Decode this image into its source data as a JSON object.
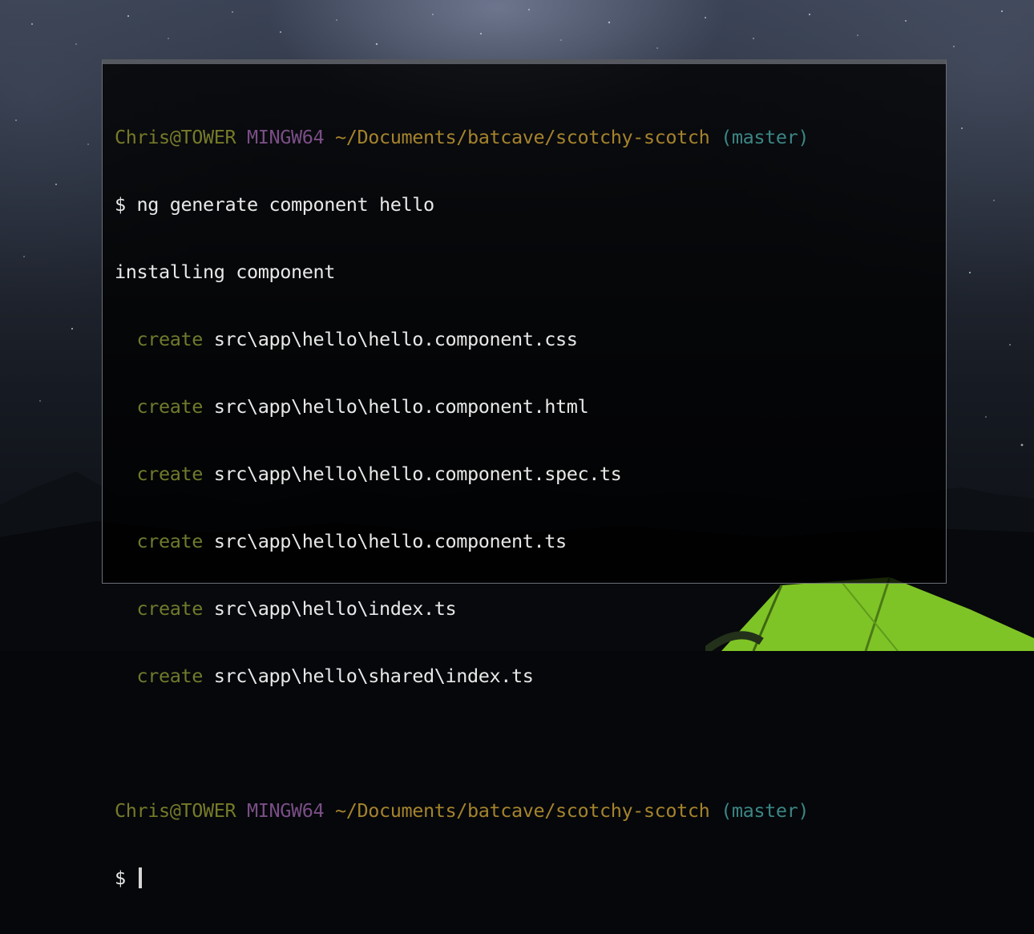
{
  "prompts": [
    {
      "user": "Chris@TOWER",
      "system": "MINGW64",
      "path": "~/Documents/batcave/scotchy-scotch",
      "branch": "(master)"
    },
    {
      "user": "Chris@TOWER",
      "system": "MINGW64",
      "path": "~/Documents/batcave/scotchy-scotch",
      "branch": "(master)"
    }
  ],
  "command": "$ ng generate component hello",
  "status_line": "installing component",
  "create_keyword": "create",
  "created_files": [
    "src\\app\\hello\\hello.component.css",
    "src\\app\\hello\\hello.component.html",
    "src\\app\\hello\\hello.component.spec.ts",
    "src\\app\\hello\\hello.component.ts",
    "src\\app\\hello\\index.ts",
    "src\\app\\hello\\shared\\index.ts"
  ],
  "input_prompt": "$",
  "colors": {
    "user": "#767a28",
    "system": "#7a4e86",
    "path": "#a5832c",
    "branch": "#3b8685",
    "create": "#707a2c",
    "text": "#e8e8e8",
    "tent": "#7fc426"
  },
  "icons": {
    "cursor": "text-cursor-block"
  }
}
